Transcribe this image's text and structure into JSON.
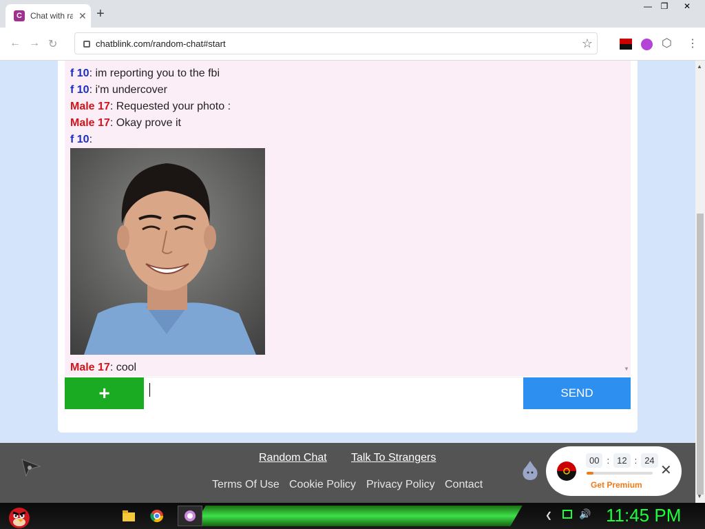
{
  "browser": {
    "tab_title": "Chat with ra",
    "tab_favicon": "C",
    "new_tab": "+",
    "url": "chatblink.com/random-chat#start",
    "minimize": "—",
    "restore": "❐",
    "close": "✕"
  },
  "chat": {
    "messages": [
      {
        "sender": "f 10",
        "text": ": im reporting you to the fbi",
        "type": "f"
      },
      {
        "sender": "f 10",
        "text": ": i'm undercover",
        "type": "f"
      },
      {
        "sender": "Male 17",
        "text": ": Requested your photo :",
        "type": "m"
      },
      {
        "sender": "Male 17",
        "text": ": Okay prove it",
        "type": "m"
      },
      {
        "sender": "f 10",
        "text": ":",
        "type": "f"
      },
      {
        "sender": "Male 17",
        "text": ": cool",
        "type": "m"
      }
    ],
    "add_label": "+",
    "input_value": "",
    "send_label": "SEND"
  },
  "footer": {
    "link_random_chat": "Random Chat",
    "link_talk": "Talk To Strangers",
    "terms": "Terms Of Use",
    "cookie": "Cookie Policy",
    "privacy": "Privacy Policy",
    "contact": "Contact"
  },
  "widget": {
    "hours": "00",
    "minutes": "12",
    "seconds": "24",
    "sep": ":",
    "progress": 0.1,
    "premium_label": "Get Premium",
    "close": "✕"
  },
  "taskbar": {
    "time": "11:45 PM"
  },
  "colors": {
    "female_sender": "#1a2fbf",
    "male_sender": "#d0141c",
    "add_button": "#1aab23",
    "send_button": "#2d8ff0",
    "chat_bg": "#fceef6",
    "clock": "#1bff3b"
  }
}
